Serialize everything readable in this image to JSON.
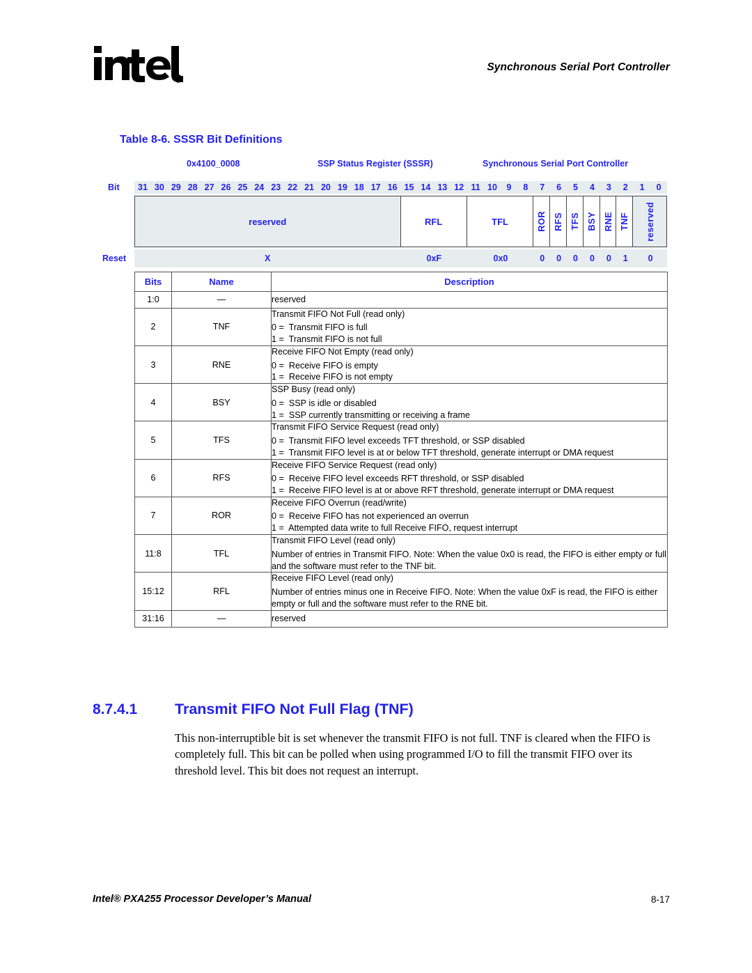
{
  "header": {
    "logo_alt": "intel-logo",
    "chapter_title": "Synchronous Serial Port Controller"
  },
  "table": {
    "caption": "Table 8-6. SSSR Bit Definitions",
    "register": {
      "address": "0x4100_0008",
      "name": "SSP Status Register (SSSR)",
      "unit": "Synchronous Serial Port Controller"
    },
    "bit_axis_label": "Bit",
    "bit_numbers": [
      "31",
      "30",
      "29",
      "28",
      "27",
      "26",
      "25",
      "24",
      "23",
      "22",
      "21",
      "20",
      "19",
      "18",
      "17",
      "16",
      "15",
      "14",
      "13",
      "12",
      "11",
      "10",
      "9",
      "8",
      "7",
      "6",
      "5",
      "4",
      "3",
      "2",
      "1",
      "0"
    ],
    "fields": [
      {
        "label": "reserved",
        "bits": 16,
        "shaded": true,
        "vertical": false
      },
      {
        "label": "RFL",
        "bits": 4,
        "shaded": false,
        "vertical": false
      },
      {
        "label": "TFL",
        "bits": 4,
        "shaded": false,
        "vertical": false
      },
      {
        "label": "ROR",
        "bits": 1,
        "shaded": false,
        "vertical": true
      },
      {
        "label": "RFS",
        "bits": 1,
        "shaded": false,
        "vertical": true
      },
      {
        "label": "TFS",
        "bits": 1,
        "shaded": false,
        "vertical": true
      },
      {
        "label": "BSY",
        "bits": 1,
        "shaded": false,
        "vertical": true
      },
      {
        "label": "RNE",
        "bits": 1,
        "shaded": false,
        "vertical": true
      },
      {
        "label": "TNF",
        "bits": 1,
        "shaded": false,
        "vertical": true
      },
      {
        "label": "reserved",
        "bits": 2,
        "shaded": true,
        "vertical": true
      }
    ],
    "reset_label": "Reset",
    "reset_values": [
      {
        "value": "X",
        "bits": 16
      },
      {
        "value": "0xF",
        "bits": 4
      },
      {
        "value": "0x0",
        "bits": 4
      },
      {
        "value": "0",
        "bits": 1
      },
      {
        "value": "0",
        "bits": 1
      },
      {
        "value": "0",
        "bits": 1
      },
      {
        "value": "0",
        "bits": 1
      },
      {
        "value": "0",
        "bits": 1
      },
      {
        "value": "1",
        "bits": 1
      },
      {
        "value": "0",
        "bits": 2
      }
    ],
    "columns": [
      "Bits",
      "Name",
      "Description"
    ],
    "rows": [
      {
        "bits": "1:0",
        "name": "—",
        "title": "reserved",
        "options": [],
        "paragraph": ""
      },
      {
        "bits": "2",
        "name": "TNF",
        "title": "Transmit FIFO Not Full (read only)",
        "options": [
          "0 =  Transmit FIFO is full",
          "1 =  Transmit FIFO is not full"
        ],
        "paragraph": ""
      },
      {
        "bits": "3",
        "name": "RNE",
        "title": "Receive FIFO Not Empty (read only)",
        "options": [
          "0 =  Receive FIFO is empty",
          "1 =  Receive FIFO is not empty"
        ],
        "paragraph": ""
      },
      {
        "bits": "4",
        "name": "BSY",
        "title": "SSP Busy (read only)",
        "options": [
          "0 =  SSP is idle or disabled",
          "1 =  SSP currently transmitting or receiving a frame"
        ],
        "paragraph": ""
      },
      {
        "bits": "5",
        "name": "TFS",
        "title": "Transmit FIFO Service Request (read only)",
        "options": [
          "0 =  Transmit FIFO level exceeds TFT threshold, or SSP disabled",
          "1 =  Transmit FIFO level is at or below TFT threshold, generate interrupt or DMA request"
        ],
        "paragraph": ""
      },
      {
        "bits": "6",
        "name": "RFS",
        "title": "Receive FIFO Service Request (read only)",
        "options": [
          "0 =  Receive FIFO level exceeds RFT threshold, or SSP disabled",
          "1 =  Receive FIFO level is at or above RFT threshold, generate interrupt or DMA request"
        ],
        "paragraph": ""
      },
      {
        "bits": "7",
        "name": "ROR",
        "title": "Receive FIFO Overrun (read/write)",
        "options": [
          "0 =  Receive FIFO has not experienced an overrun",
          "1 =  Attempted data write to full Receive FIFO, request interrupt"
        ],
        "paragraph": ""
      },
      {
        "bits": "11:8",
        "name": "TFL",
        "title": "Transmit FIFO Level (read only)",
        "options": [],
        "paragraph": "Number of entries in Transmit FIFO. Note: When the value 0x0 is read, the FIFO is either empty or full and the software must refer to the TNF bit."
      },
      {
        "bits": "15:12",
        "name": "RFL",
        "title": "Receive FIFO Level (read only)",
        "options": [],
        "paragraph": "Number of entries minus one in Receive FIFO. Note: When the value 0xF is read, the FIFO is either empty or full and the software must refer to the RNE bit."
      },
      {
        "bits": "31:16",
        "name": "—",
        "title": "reserved",
        "options": [],
        "paragraph": ""
      }
    ]
  },
  "section": {
    "number": "8.7.4.1",
    "title": "Transmit FIFO Not Full Flag (TNF)",
    "body": "This non-interruptible bit is set whenever the transmit FIFO is not full. TNF is cleared when the FIFO is completely full. This bit can be polled when using programmed I/O to fill the transmit FIFO over its threshold level. This bit does not request an interrupt."
  },
  "footer": {
    "left": "Intel® PXA255 Processor Developer’s Manual",
    "page": "8-17"
  },
  "colors": {
    "accent_blue": "#2222ee",
    "shade": "#e7ecee",
    "border": "#555555",
    "text": "#000000"
  }
}
